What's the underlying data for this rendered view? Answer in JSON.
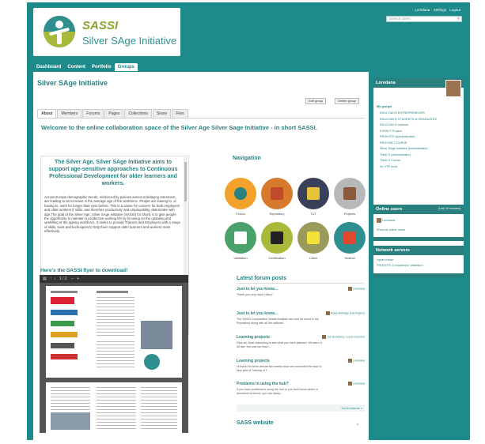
{
  "header": {
    "logo_title": "SASSI",
    "logo_subtitle": "Silver SAge Initiative",
    "top_links": [
      "Loredana",
      "Settings",
      "Logout"
    ],
    "search_placeholder": "Search users"
  },
  "nav": [
    "Dashboard",
    "Content",
    "Portfolio",
    "Groups"
  ],
  "page": {
    "title": "Silver SAge Initiative",
    "edit_group": "Edit group",
    "delete_group": "Delete group",
    "tabs": [
      "About",
      "Members",
      "Forums",
      "Pages",
      "Collections",
      "Share",
      "Files"
    ],
    "welcome": "Welcome to the online collaboration space of the Silver Age Silver Sage Initiative - in short SASSI."
  },
  "aims": {
    "heading": "The Silver Age, Silver SAge Initiative aims to support age-sensitive approaches to Continuous Professional Development for older learners and workers.",
    "body": "Across Europe demographic trends, reinforced by policies aimed at delaying retirement, are leading to an increase in the average age of the workforce. People are leaving to, or having to, work for longer than ever before. This is a cause for concern for both employers and older workers if skills, and therefore productivity and employability, deteriorate with age.The goal of the Silver Age, Silver SAge Initiative (SASSI) for short) is to give people the opportunity to maintain a productive working life by focusing on the updating and upskilling of the ageing workforce. It seeks to provide Trainers and Employers with a range of skills, tools and techniques to help them support older learners and workers more effectively."
  },
  "navigation": {
    "heading": "Navigation",
    "items": [
      {
        "label": "Forum",
        "icon": "speech-bubble-icon",
        "color": "#f2a22a",
        "inner": "#2a7f7f"
      },
      {
        "label": "Repository",
        "icon": "book-icon",
        "color": "#d77a2e",
        "inner": "#c04a2a"
      },
      {
        "label": "ToT",
        "icon": "notebook-icon",
        "color": "#3a3f5a",
        "inner": "#e5c23a"
      },
      {
        "label": "Projects",
        "icon": "books-icon",
        "color": "#b6b8ba",
        "inner": "#8a5a3a"
      },
      {
        "label": "Validation",
        "icon": "set-square-icon",
        "color": "#4aa16a",
        "inner": "#ffffff"
      },
      {
        "label": "Certification",
        "icon": "graduation-cap-icon",
        "color": "#a9b93b",
        "inner": "#222222"
      },
      {
        "label": "Label",
        "icon": "medal-icon",
        "color": "#9a9a5a",
        "inner": "#f4e03a"
      },
      {
        "label": "Toolbox",
        "icon": "toolbox-icon",
        "color": "#2f8f8f",
        "inner": "#e0492f"
      }
    ]
  },
  "flyer": {
    "heading": "Here's the SASSI flyer to download!",
    "page_indicator": "1 / 2"
  },
  "forum": {
    "heading": "Latest forum posts",
    "posts": [
      {
        "title": "Just to let you know...",
        "text": "Thank you very much Hilary!",
        "user": "Loredana"
      },
      {
        "title": "Just to let you know...",
        "text": "The SASSI Comparative Needs Analysis can now be found in the Repository along with all the national ...",
        "user": "Hilary Aldridge (Harrington)"
      },
      {
        "title": "Learning projects",
        "text": "Dear all, Most interesting to see what you have planned. We were a bit late, but now our team...",
        "user": "Joe Buonomo, Lucia Guerrieri"
      },
      {
        "title": "Learning projects",
        "text": "Hi there! It's been almost two weeks since we concluded the face to face part of Training of T...",
        "user": "Loredana"
      },
      {
        "title": "Problems in using the hub?",
        "text": "If you have problems in using the hub or you don't know where a document is stored, you can alway...",
        "user": "Loredana"
      }
    ],
    "go_to_forums": "Go to forums »"
  },
  "website": {
    "heading": "SASS website"
  },
  "sidebar": {
    "user_name": "Loredana",
    "my_groups_label": "My groups",
    "groups": [
      "EDUCOACH ENTREPRENEURS",
      "EDUCOACH STUDENTS of GRADUATES",
      "EDUCOACH network",
      "EXPACT Project",
      "PROKOTS (Administrator)",
      "PROVIDE COURSE",
      "Silver SAge Initiative (Administrator)",
      "Think D (Administrator)",
      "Think D Course",
      "Vu VTR tools"
    ],
    "online_users_label": "Online users",
    "online_users_note": "(Last 10 minutes)",
    "online_user": "Loredana",
    "show_all_online": "Show all online users",
    "network_label": "Network servers",
    "network_items": [
      "Hyper Inside",
      "PROKOTS Competence Validation"
    ]
  }
}
